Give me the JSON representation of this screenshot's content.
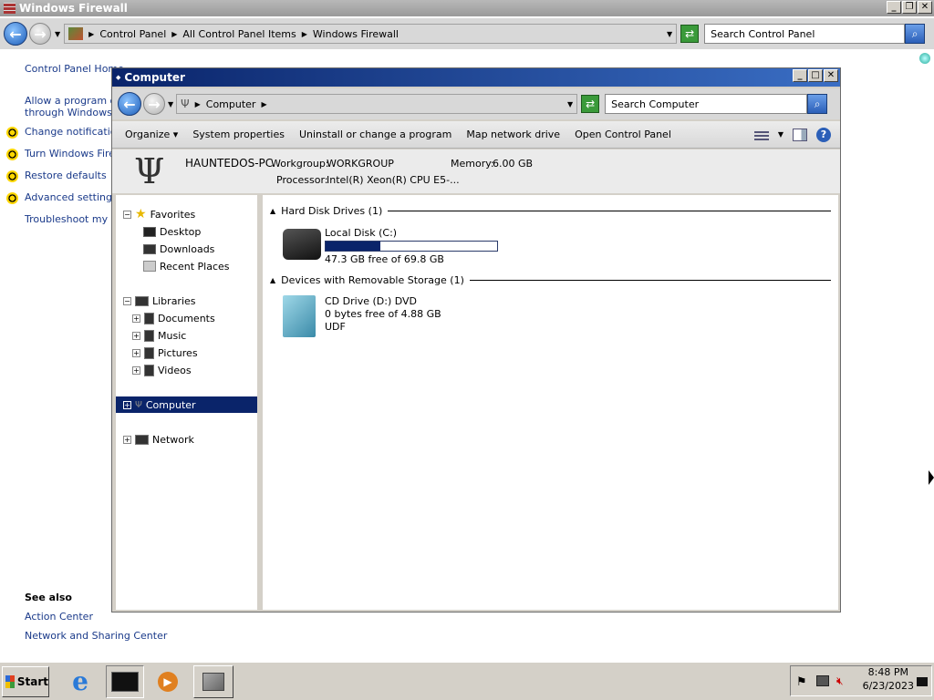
{
  "back_window": {
    "title": "Windows Firewall",
    "breadcrumbs": [
      "Control Panel",
      "All Control Panel Items",
      "Windows Firewall"
    ],
    "search_placeholder": "Search Control Panel",
    "links": [
      {
        "label": "Control Panel Home",
        "shield": false
      },
      {
        "label": "Allow a program or f",
        "shield": false
      },
      {
        "label": "through Windows Fi",
        "shield": false
      },
      {
        "label": "Change notification",
        "shield": true
      },
      {
        "label": "Turn Windows Firew",
        "shield": true
      },
      {
        "label": "Restore defaults",
        "shield": true
      },
      {
        "label": "Advanced settings",
        "shield": true
      },
      {
        "label": "Troubleshoot my ne",
        "shield": false
      }
    ],
    "see_also": {
      "heading": "See also",
      "links": [
        "Action Center",
        "Network and Sharing Center"
      ]
    }
  },
  "window": {
    "title": "Computer",
    "breadcrumb": "Computer",
    "search_placeholder": "Search Computer",
    "toolbar": {
      "organize": "Organize",
      "items": [
        "System properties",
        "Uninstall or change a program",
        "Map network drive",
        "Open Control Panel"
      ]
    },
    "info": {
      "pc_name": "HAUNTEDOS-PC",
      "workgroup_label": "Workgroup:",
      "workgroup": "WORKGROUP",
      "memory_label": "Memory:",
      "memory": "6.00 GB",
      "processor_label": "Processor:",
      "processor": "Intel(R) Xeon(R) CPU E5-..."
    },
    "nav": {
      "favorites": {
        "label": "Favorites",
        "items": [
          "Desktop",
          "Downloads",
          "Recent Places"
        ]
      },
      "libraries": {
        "label": "Libraries",
        "items": [
          "Documents",
          "Music",
          "Pictures",
          "Videos"
        ]
      },
      "computer": "Computer",
      "network": "Network"
    },
    "groups": {
      "hdd_label": "Hard Disk Drives (1)",
      "removable_label": "Devices with Removable Storage (1)"
    },
    "drives": [
      {
        "name": "Local Disk (C:)",
        "detail": "47.3 GB free of 69.8 GB",
        "used_fraction": 0.32
      },
      {
        "name": "CD Drive (D:) DVD",
        "detail": "0 bytes free of 4.88 GB",
        "extra": "UDF"
      }
    ]
  },
  "taskbar": {
    "start": "Start",
    "time": "8:48 PM",
    "date": "6/23/2023"
  },
  "colors": {
    "link": "#1a3a8a",
    "selection": "#0a246a",
    "title_active": "#0a246a"
  },
  "icons": [
    "firewall-icon",
    "back-arrow-icon",
    "forward-arrow-icon",
    "refresh-icon",
    "search-icon",
    "computer-quake-icon",
    "star-icon",
    "folder-icon",
    "library-icon",
    "hard-drive-icon",
    "cd-drive-icon",
    "network-icon",
    "ie-icon",
    "media-player-icon",
    "flag-icon",
    "speaker-muted-icon"
  ]
}
